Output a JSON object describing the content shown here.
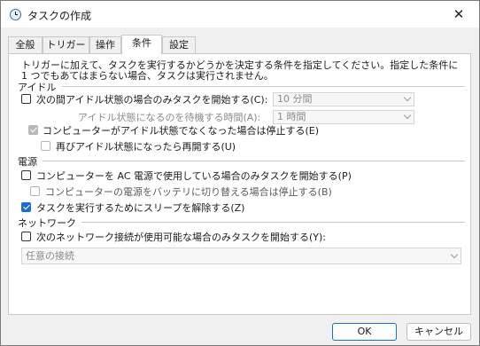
{
  "window": {
    "title": "タスクの作成",
    "close_glyph": "✕"
  },
  "tabs": [
    {
      "label": "全般"
    },
    {
      "label": "トリガー"
    },
    {
      "label": "操作"
    },
    {
      "label": "条件",
      "active": true
    },
    {
      "label": "設定"
    }
  ],
  "description": "トリガーに加えて、タスクを実行するかどうかを決定する条件を指定してください。指定した条件に 1 つでもあてはまらない場合、タスクは実行されません。",
  "idle": {
    "heading": "アイドル",
    "start_only_if_idle": {
      "label": "次の間アイドル状態の場合のみタスクを開始する(C):",
      "checked": false
    },
    "idle_duration": {
      "value": "10 分間"
    },
    "wait_label": "アイドル状態になるのを待機する時間(A):",
    "wait_duration": {
      "value": "1 時間"
    },
    "stop_if_not_idle": {
      "label": "コンピューターがアイドル状態でなくなった場合は停止する(E)",
      "checked": true
    },
    "restart_if_idle": {
      "label": "再びアイドル状態になったら再開する(U)",
      "checked": false
    }
  },
  "power": {
    "heading": "電源",
    "ac_only": {
      "label": "コンピューターを AC 電源で使用している場合のみタスクを開始する(P)",
      "checked": false
    },
    "stop_on_battery": {
      "label": "コンピューターの電源をバッテリに切り替える場合は停止する(B)",
      "checked": false
    },
    "wake_to_run": {
      "label": "タスクを実行するためにスリープを解除する(Z)",
      "checked": true
    }
  },
  "network": {
    "heading": "ネットワーク",
    "network_only": {
      "label": "次のネットワーク接続が使用可能な場合のみタスクを開始する(Y):",
      "checked": false
    },
    "connection": {
      "value": "任意の接続"
    }
  },
  "buttons": {
    "ok": "OK",
    "cancel": "キャンセル"
  },
  "colors": {
    "accent": "#1a6fc9",
    "panel": "#ffffff",
    "chrome": "#f0f0f0"
  }
}
